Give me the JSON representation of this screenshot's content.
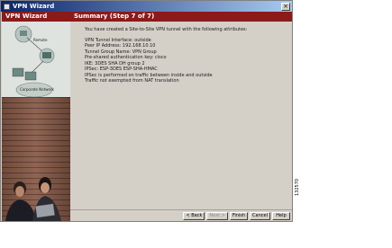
{
  "window": {
    "title": "VPN Wizard",
    "close_glyph": "×"
  },
  "left_panel": {
    "header": "VPN Wizard",
    "diagram_labels": [
      "Remote",
      "Corporate Network"
    ]
  },
  "right_panel": {
    "header": "Summary  (Step 7 of 7)",
    "intro": "You have created a Site-to-Site VPN tunnel with the following attributes:",
    "lines": [
      "VPN Tunnel Interface: outside",
      "Peer IP Address: 192.168.10.10",
      "Tunnel Group Name: VPN Group",
      "Pre-shared authentication key: cisco",
      "IKE: 3DES SHA DH group 2",
      "IPSec: ESP-3DES ESP-SHA-HMAC",
      "IPSec is performed on traffic between inside and outside",
      "Traffic not exempted from NAT translation"
    ]
  },
  "buttons": {
    "back": "< Back",
    "next": "Next >",
    "finish": "Finish",
    "cancel": "Cancel",
    "help": "Help"
  },
  "figure_id": "132570"
}
